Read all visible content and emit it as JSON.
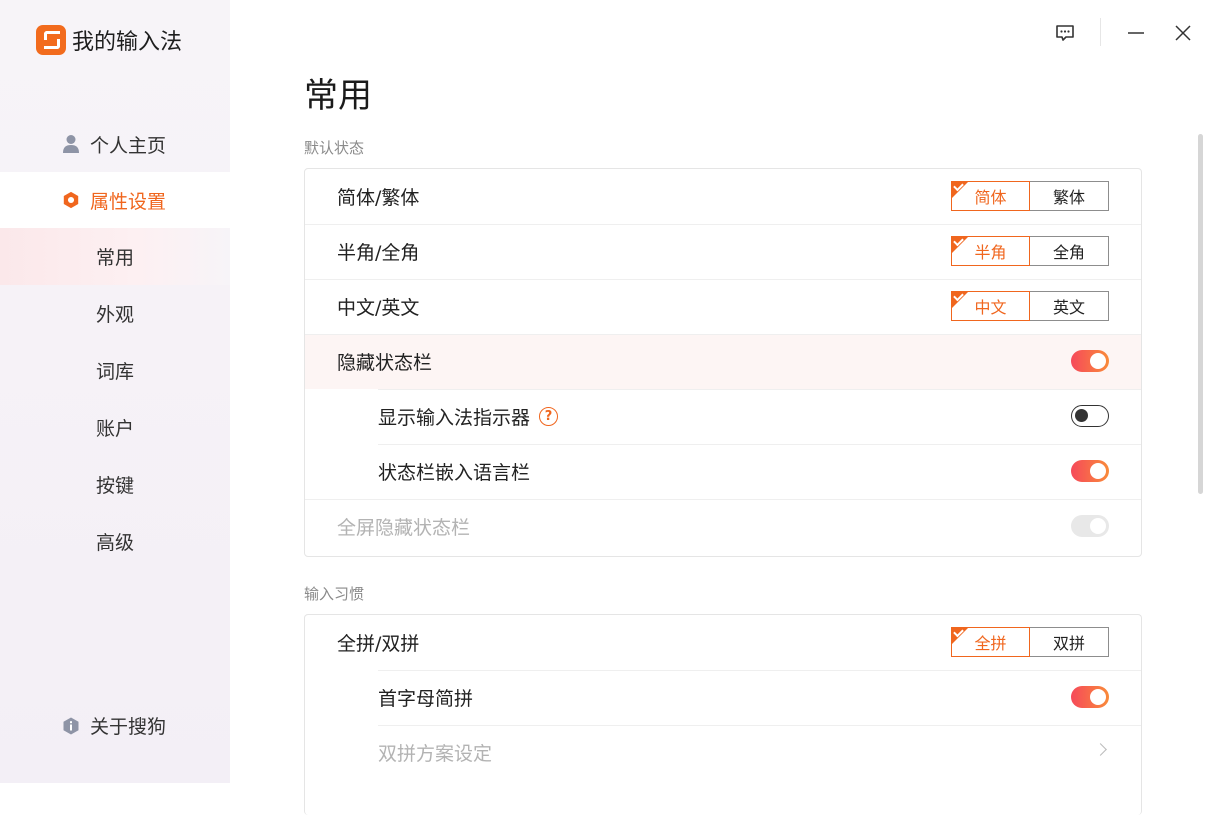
{
  "app": {
    "title": "我的输入法",
    "brand_color": "#f0661e"
  },
  "sidebar": {
    "items": [
      {
        "label": "个人主页",
        "icon": "user-icon"
      },
      {
        "label": "属性设置",
        "icon": "settings-hex-icon"
      }
    ],
    "subitems": [
      "常用",
      "外观",
      "词库",
      "账户",
      "按键",
      "高级"
    ],
    "about": {
      "label": "关于搜狗",
      "icon": "info-icon"
    }
  },
  "main": {
    "title": "常用",
    "sections": [
      {
        "label": "默认状态",
        "rows": [
          {
            "label": "简体/繁体",
            "options": [
              "简体",
              "繁体"
            ],
            "selected": "简体"
          },
          {
            "label": "半角/全角",
            "options": [
              "半角",
              "全角"
            ],
            "selected": "半角"
          },
          {
            "label": "中文/英文",
            "options": [
              "中文",
              "英文"
            ],
            "selected": "中文"
          },
          {
            "label": "隐藏状态栏",
            "toggle": true
          },
          {
            "label": "显示输入法指示器",
            "toggle": false
          },
          {
            "label": "状态栏嵌入语言栏",
            "toggle": true
          },
          {
            "label": "全屏隐藏状态栏",
            "toggle": true,
            "disabled": true
          }
        ]
      },
      {
        "label": "输入习惯",
        "rows": [
          {
            "label": "全拼/双拼",
            "options": [
              "全拼",
              "双拼"
            ],
            "selected": "全拼"
          },
          {
            "label": "首字母简拼",
            "toggle": true
          },
          {
            "label": "双拼方案设定",
            "disabled": true
          }
        ]
      }
    ]
  }
}
